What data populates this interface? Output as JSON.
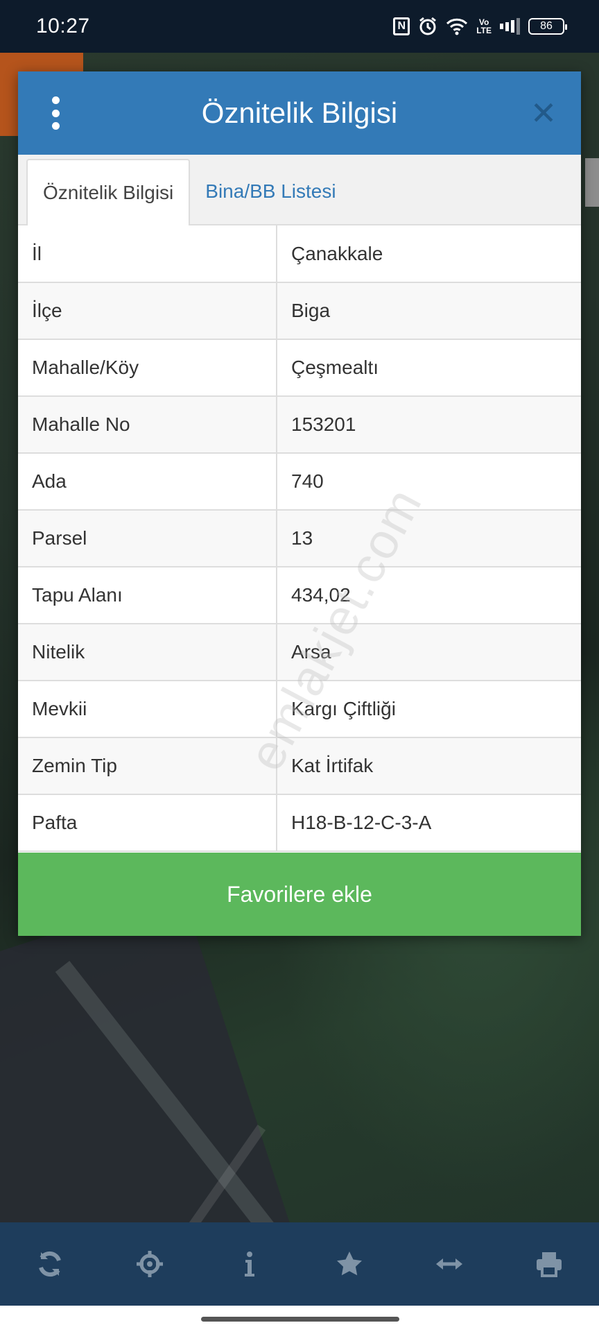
{
  "status_bar": {
    "time": "10:27",
    "volte_top": "Vo",
    "volte_bottom": "LTE",
    "battery": "86",
    "icons": [
      "nfc-icon",
      "alarm-icon",
      "wifi-icon",
      "volte-icon",
      "signal-icon",
      "battery-icon"
    ]
  },
  "modal": {
    "title": "Öznitelik Bilgisi",
    "tabs": [
      {
        "label": "Öznitelik Bilgisi",
        "active": true
      },
      {
        "label": "Bina/BB Listesi",
        "active": false
      }
    ],
    "rows": [
      {
        "key": "İl",
        "value": "Çanakkale"
      },
      {
        "key": "İlçe",
        "value": "Biga"
      },
      {
        "key": "Mahalle/Köy",
        "value": "Çeşmealtı"
      },
      {
        "key": "Mahalle No",
        "value": "153201"
      },
      {
        "key": "Ada",
        "value": "740"
      },
      {
        "key": "Parsel",
        "value": "13"
      },
      {
        "key": "Tapu Alanı",
        "value": "434,02"
      },
      {
        "key": "Nitelik",
        "value": "Arsa"
      },
      {
        "key": "Mevkii",
        "value": "Kargı Çiftliği"
      },
      {
        "key": "Zemin Tip",
        "value": "Kat İrtifak"
      },
      {
        "key": "Pafta",
        "value": "H18-B-12-C-3-A"
      }
    ],
    "favorite_button": "Favorilere ekle",
    "watermark": "emlakjet.com"
  },
  "toolbar": {
    "icons": [
      "refresh-icon",
      "locate-icon",
      "info-icon",
      "star-icon",
      "measure-icon",
      "print-icon"
    ]
  },
  "colors": {
    "header_blue": "#337ab7",
    "favorite_green": "#5cb85c",
    "toolbar_bg": "#1e3d5c",
    "status_bg": "#0d1b2b"
  }
}
